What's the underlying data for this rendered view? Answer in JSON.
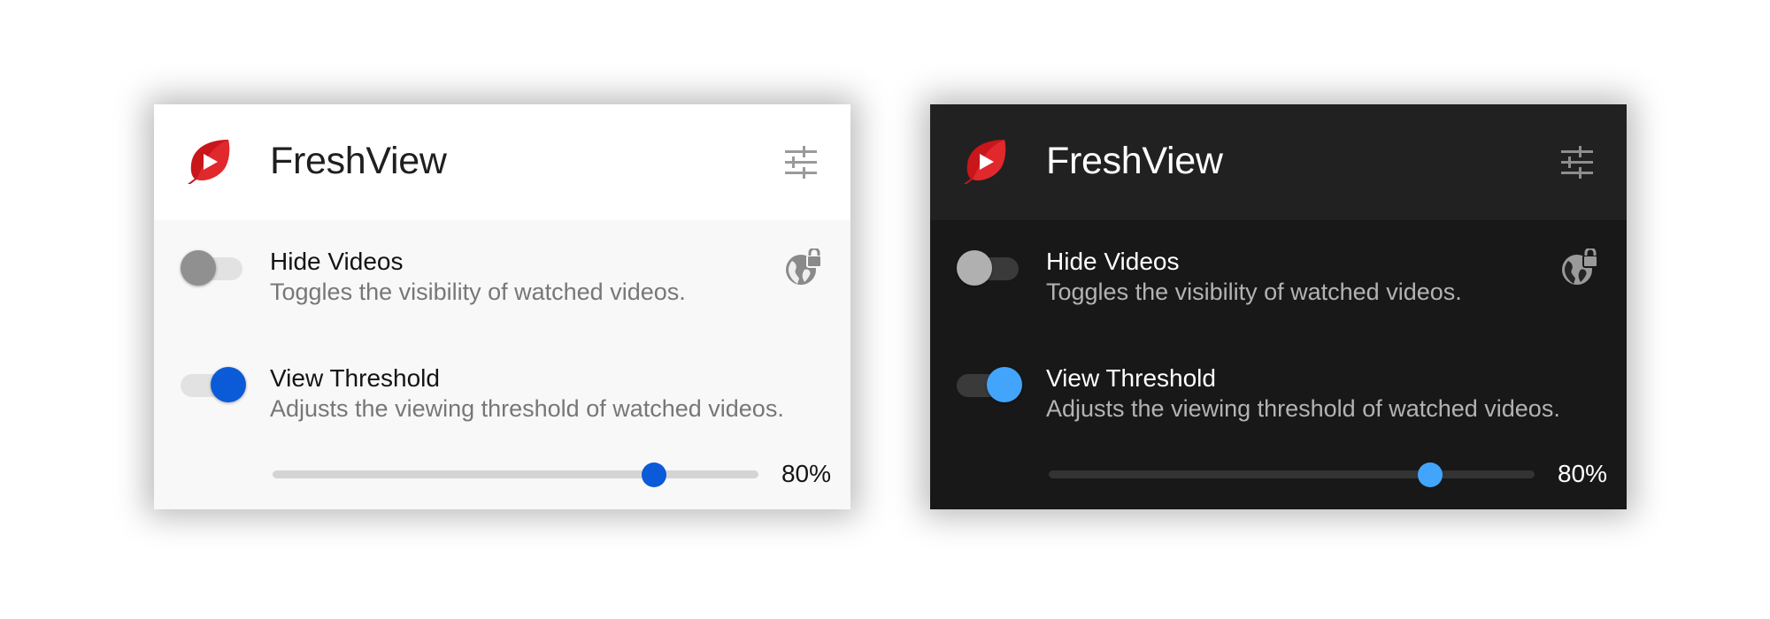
{
  "panels": [
    {
      "theme": "light",
      "app_title": "FreshView",
      "logo_icon": "leaf-play-logo",
      "settings_icon": "tune-sliders-icon",
      "hide_videos": {
        "label": "Hide Videos",
        "description": "Toggles the visibility of watched videos.",
        "enabled": false,
        "scope_icon": "globe-lock-icon"
      },
      "view_threshold": {
        "label": "View Threshold",
        "description": "Adjusts the viewing threshold of watched videos.",
        "enabled": true,
        "value": 0.8,
        "value_text": "80%"
      },
      "colors": {
        "accent": "#0b5ad8",
        "background": "#f8f8f8",
        "header": "#ffffff"
      }
    },
    {
      "theme": "dark",
      "app_title": "FreshView",
      "logo_icon": "leaf-play-logo",
      "settings_icon": "tune-sliders-icon",
      "hide_videos": {
        "label": "Hide Videos",
        "description": "Toggles the visibility of watched videos.",
        "enabled": false,
        "scope_icon": "globe-lock-icon"
      },
      "view_threshold": {
        "label": "View Threshold",
        "description": "Adjusts the viewing threshold of watched videos.",
        "enabled": true,
        "value": 0.8,
        "value_text": "80%"
      },
      "colors": {
        "accent": "#42a5fb",
        "background": "#181818",
        "header": "#212121"
      }
    }
  ]
}
